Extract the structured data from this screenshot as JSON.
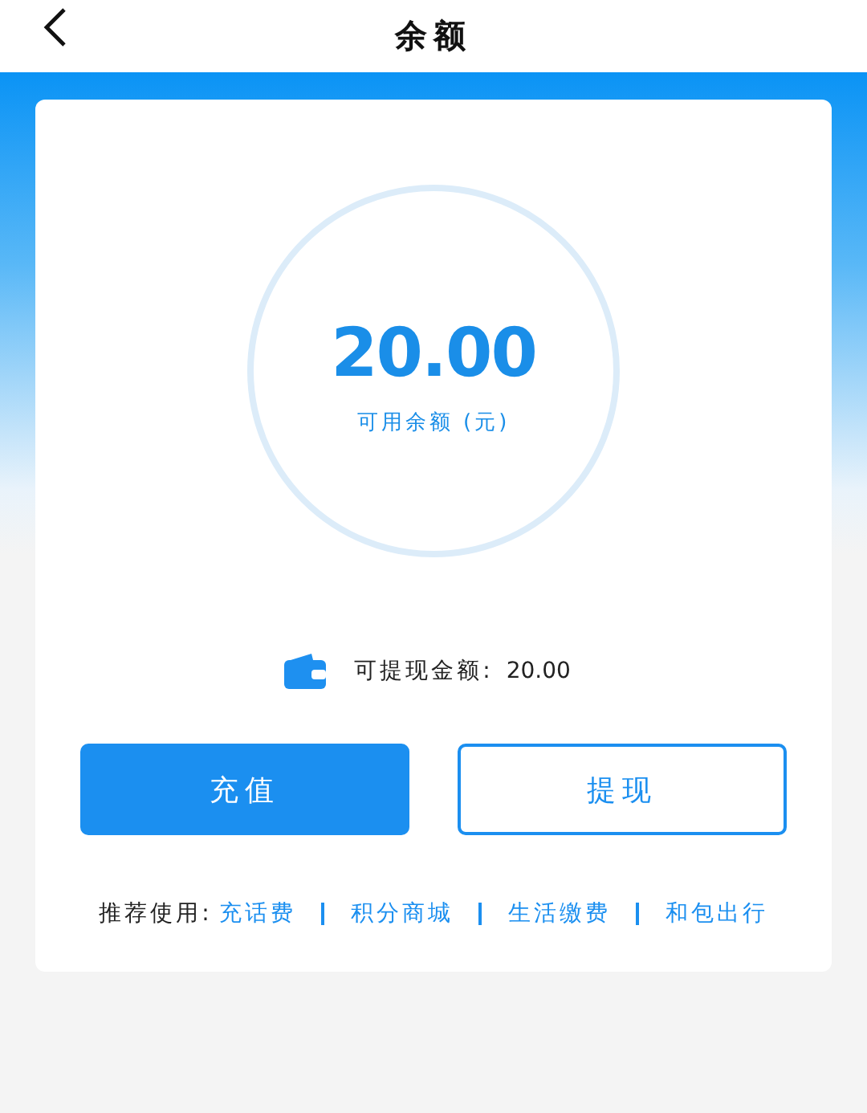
{
  "header": {
    "title": "余额"
  },
  "balance": {
    "amount": "20.00",
    "label": "可用余额 (元)"
  },
  "withdrawable": {
    "label": "可提现金额:",
    "amount": "20.00"
  },
  "buttons": [
    {
      "label": "充值",
      "kind": "primary"
    },
    {
      "label": "提现",
      "kind": "outline"
    }
  ],
  "recommend": {
    "label": "推荐使用:",
    "links": [
      "充话费",
      "积分商城",
      "生活缴费",
      "和包出行"
    ]
  }
}
